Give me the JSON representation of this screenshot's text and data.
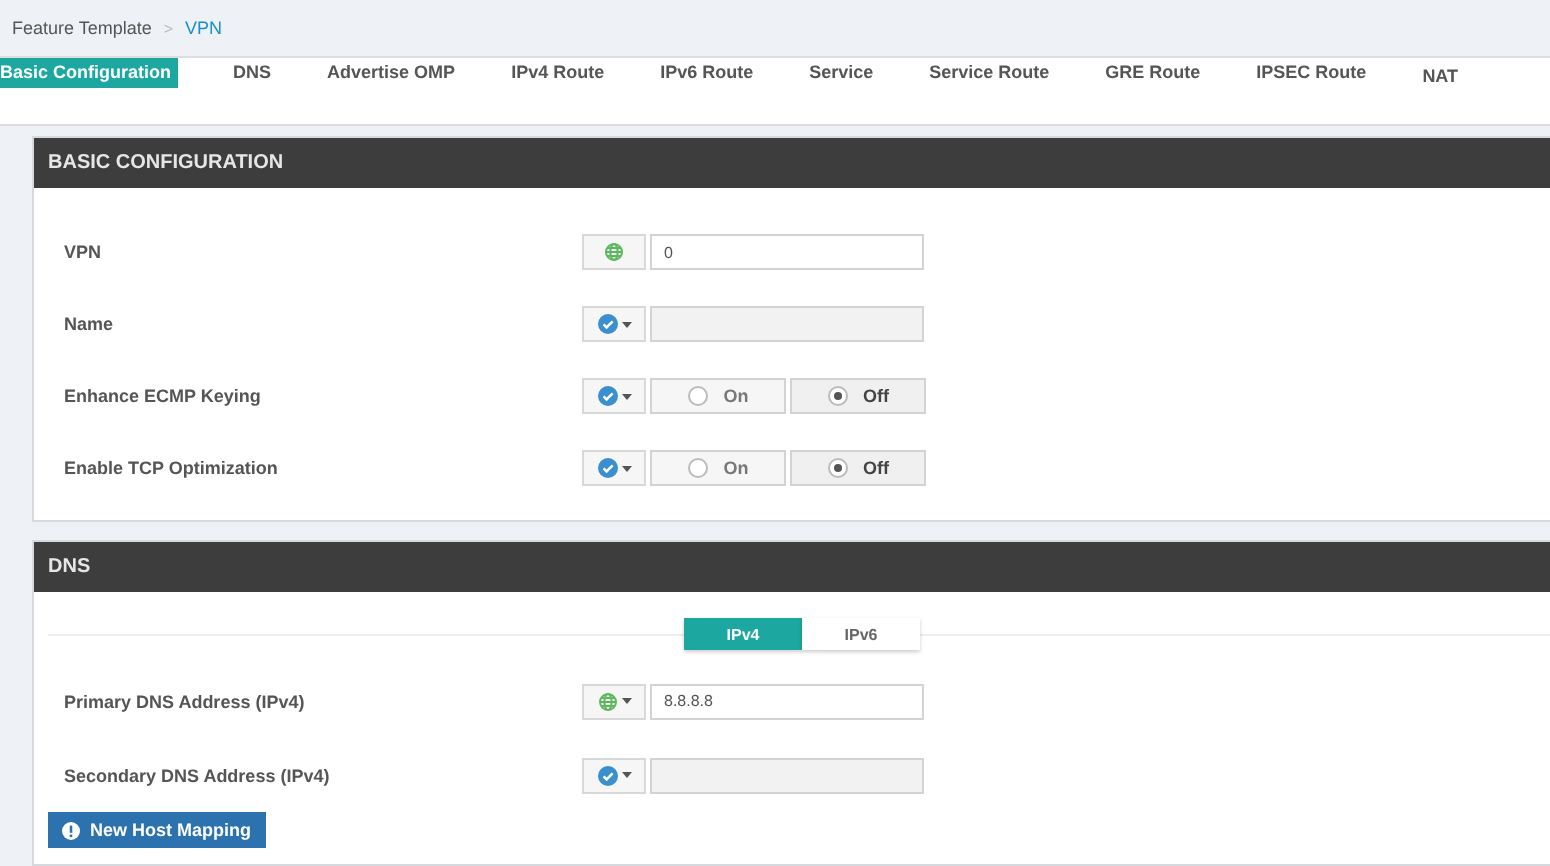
{
  "breadcrumb": [
    {
      "label": "Feature Template",
      "current": false
    },
    {
      "label": "VPN",
      "current": true
    }
  ],
  "breadcrumb_separator": ">",
  "tabs": [
    {
      "label": "Basic Configuration",
      "selected": true
    },
    {
      "label": "DNS",
      "selected": false
    },
    {
      "label": "Advertise OMP",
      "selected": false
    },
    {
      "label": "IPv4 Route",
      "selected": false
    },
    {
      "label": "IPv6 Route",
      "selected": false
    },
    {
      "label": "Service",
      "selected": false
    },
    {
      "label": "Service Route",
      "selected": false
    },
    {
      "label": "GRE Route",
      "selected": false
    },
    {
      "label": "IPSEC Route",
      "selected": false
    },
    {
      "label": "NAT",
      "selected": false
    }
  ],
  "sections": [
    {
      "title": "BASIC CONFIGURATION",
      "fields": [
        {
          "label": "VPN",
          "kind": "text",
          "scope": {
            "kind": "global",
            "dropdown": false
          },
          "value": "0"
        },
        {
          "label": "Name",
          "kind": "text",
          "scope": {
            "kind": "default",
            "dropdown": true
          }
        },
        {
          "label": "Enhance ECMP Keying",
          "kind": "radio",
          "scope": {
            "kind": "default",
            "dropdown": true
          },
          "options": [
            {
              "label": "On",
              "selected": false
            },
            {
              "label": "Off",
              "selected": true
            }
          ]
        },
        {
          "label": "Enable TCP Optimization",
          "kind": "radio",
          "scope": {
            "kind": "default",
            "dropdown": true
          },
          "options": [
            {
              "label": "On",
              "selected": false
            },
            {
              "label": "Off",
              "selected": true
            }
          ]
        }
      ]
    },
    {
      "title": "DNS",
      "toggle": [
        {
          "label": "IPv4",
          "selected": true
        },
        {
          "label": "IPv6",
          "selected": false
        }
      ],
      "fields": [
        {
          "label": "Primary DNS Address (IPv4)",
          "kind": "text",
          "scope": {
            "kind": "global",
            "dropdown": true
          },
          "value": "8.8.8.8"
        },
        {
          "label": "Secondary DNS Address (IPv4)",
          "kind": "text",
          "scope": {
            "kind": "default",
            "dropdown": true
          }
        }
      ],
      "button": "New Host Mapping"
    }
  ]
}
